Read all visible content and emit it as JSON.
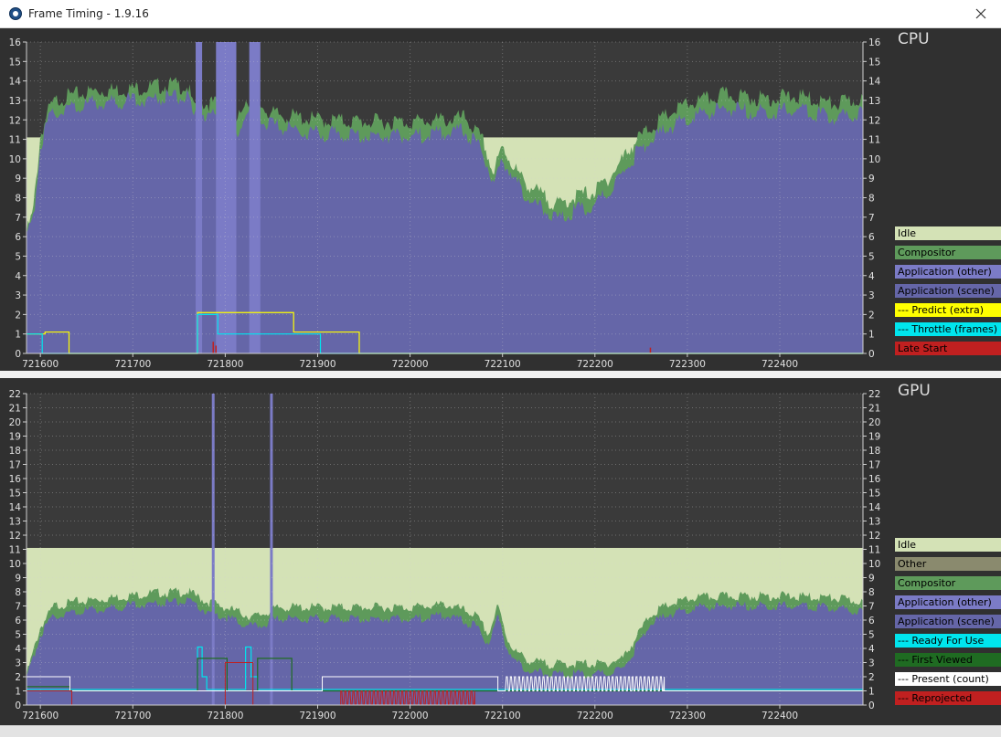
{
  "window": {
    "title": "Frame Timing - 1.9.16"
  },
  "cpu_panel": {
    "title": "CPU",
    "legend": [
      {
        "label": "Idle",
        "bg": "#d4e2b6",
        "fg": "#000000"
      },
      {
        "label": "Compositor",
        "bg": "#5e9a5b",
        "fg": "#000000"
      },
      {
        "label": "Application (other)",
        "bg": "#7b7bc6",
        "fg": "#000000"
      },
      {
        "label": "Application (scene)",
        "bg": "#6566a8",
        "fg": "#000000"
      },
      {
        "label": "--- Predict (extra)",
        "bg": "#ffff00",
        "fg": "#000000"
      },
      {
        "label": "--- Throttle (frames)",
        "bg": "#00e5ee",
        "fg": "#000000"
      },
      {
        "label": "Late Start",
        "bg": "#c02020",
        "fg": "#000000"
      }
    ]
  },
  "gpu_panel": {
    "title": "GPU",
    "legend": [
      {
        "label": "Idle",
        "bg": "#d4e2b6",
        "fg": "#000000"
      },
      {
        "label": "Other",
        "bg": "#8a8a6e",
        "fg": "#000000"
      },
      {
        "label": "Compositor",
        "bg": "#5e9a5b",
        "fg": "#000000"
      },
      {
        "label": "Application (other)",
        "bg": "#7b7bc6",
        "fg": "#000000"
      },
      {
        "label": "Application (scene)",
        "bg": "#6566a8",
        "fg": "#000000"
      },
      {
        "label": "--- Ready For Use",
        "bg": "#00e5ee",
        "fg": "#000000"
      },
      {
        "label": "--- First Viewed",
        "bg": "#1f6b22",
        "fg": "#000000"
      },
      {
        "label": "--- Present (count)",
        "bg": "#ffffff",
        "fg": "#000000"
      },
      {
        "label": "--- Reprojected",
        "bg": "#c02020",
        "fg": "#000000"
      }
    ]
  },
  "chart_data": [
    {
      "type": "area",
      "id": "cpu",
      "title": "CPU",
      "xlabel": "",
      "ylabel": "",
      "xlim": [
        721585,
        722490
      ],
      "ylim": [
        0,
        16
      ],
      "x_ticks": [
        721600,
        721700,
        721800,
        721900,
        722000,
        722100,
        722200,
        722300,
        722400
      ],
      "y_ticks": [
        0,
        1,
        2,
        3,
        4,
        5,
        6,
        7,
        8,
        9,
        10,
        11,
        12,
        13,
        14,
        15,
        16
      ],
      "grid": true,
      "budget_line": 11.1,
      "series": [
        {
          "name": "Idle",
          "color": "#d4e2b6",
          "kind": "fill_to_budget"
        },
        {
          "name": "Compositor",
          "color": "#5e9a5b",
          "kind": "area",
          "x": [
            721585,
            721592,
            721600,
            721610,
            721620,
            721640,
            721660,
            721700,
            721740,
            721760,
            721766,
            721768,
            721800,
            721812,
            721820,
            721830,
            721850,
            721900,
            721950,
            722000,
            722040,
            722060,
            722080,
            722090,
            722100,
            722120,
            722140,
            722160,
            722180,
            722200,
            722220,
            722240,
            722260,
            722280,
            722300,
            722340,
            722380,
            722420,
            722460,
            722490
          ],
          "values": [
            6.2,
            7.2,
            11.2,
            12.6,
            13.1,
            13.3,
            13.5,
            13.6,
            13.8,
            13.7,
            12.5,
            12.9,
            12.8,
            11.6,
            13.0,
            13.1,
            12.3,
            12.0,
            11.9,
            11.9,
            12.0,
            12.1,
            10.8,
            9.2,
            10.6,
            9.0,
            8.2,
            7.6,
            8.1,
            8.3,
            9.3,
            10.7,
            11.6,
            12.3,
            12.8,
            13.3,
            13.1,
            13.2,
            12.8,
            13.1
          ]
        },
        {
          "name": "Application (other)",
          "color": "#7b7bc6",
          "kind": "bars",
          "ranges": [
            [
              721768,
              721775,
              16
            ],
            [
              721790,
              721812,
              16
            ],
            [
              721826,
              721838,
              16
            ]
          ]
        },
        {
          "name": "Application (scene)",
          "color": "#6566a8",
          "kind": "area",
          "x": [
            721585,
            721592,
            721600,
            721610,
            721620,
            721640,
            721660,
            721700,
            721740,
            721760,
            721766,
            721768,
            721800,
            721812,
            721820,
            721830,
            721850,
            721900,
            721950,
            722000,
            722040,
            722060,
            722080,
            722090,
            722100,
            722120,
            722140,
            722160,
            722180,
            722200,
            722220,
            722240,
            722260,
            722280,
            722300,
            722340,
            722380,
            722420,
            722460,
            722490
          ],
          "values": [
            5.9,
            6.8,
            10.7,
            12.1,
            12.5,
            12.7,
            12.9,
            13.0,
            13.2,
            13.1,
            11.9,
            12.3,
            12.2,
            11.0,
            12.3,
            12.4,
            11.7,
            11.3,
            11.2,
            11.2,
            11.3,
            11.4,
            10.2,
            8.6,
            10.0,
            8.4,
            7.5,
            6.9,
            7.4,
            7.6,
            8.6,
            10.0,
            10.9,
            11.6,
            12.1,
            12.6,
            12.4,
            12.5,
            12.1,
            12.4
          ]
        },
        {
          "name": "--- Predict (extra)",
          "color": "#ffff00",
          "kind": "step",
          "x": [
            721585,
            721605,
            721628,
            721631,
            721762,
            721770,
            721871,
            721874,
            721942,
            721945,
            722490
          ],
          "values": [
            1.0,
            1.1,
            1.1,
            0.0,
            0.0,
            2.1,
            2.1,
            1.1,
            1.1,
            0.0,
            0.0
          ]
        },
        {
          "name": "--- Throttle (frames)",
          "color": "#00e5ee",
          "kind": "step",
          "x": [
            721585,
            721600,
            721602,
            721766,
            721770,
            721790,
            721792,
            721901,
            721903,
            722490
          ],
          "values": [
            1.0,
            1.0,
            0.0,
            0.0,
            2.0,
            2.0,
            1.0,
            1.0,
            0.0,
            0.0
          ]
        },
        {
          "name": "Late Start",
          "color": "#c02020",
          "kind": "spikes",
          "x": [
            721787,
            721790,
            722260
          ],
          "values": [
            0.6,
            0.4,
            0.3
          ]
        }
      ]
    },
    {
      "type": "area",
      "id": "gpu",
      "title": "GPU",
      "xlabel": "",
      "ylabel": "",
      "xlim": [
        721585,
        722490
      ],
      "ylim": [
        0,
        22
      ],
      "x_ticks": [
        721600,
        721700,
        721800,
        721900,
        722000,
        722100,
        722200,
        722300,
        722400
      ],
      "y_ticks": [
        0,
        1,
        2,
        3,
        4,
        5,
        6,
        7,
        8,
        9,
        10,
        11,
        12,
        13,
        14,
        15,
        16,
        17,
        18,
        19,
        20,
        21,
        22
      ],
      "grid": true,
      "budget_line": 11.1,
      "series": [
        {
          "name": "Idle",
          "color": "#d4e2b6",
          "kind": "fill_to_budget"
        },
        {
          "name": "Compositor",
          "color": "#5e9a5b",
          "kind": "area",
          "x": [
            721585,
            721600,
            721615,
            721640,
            721680,
            721720,
            721760,
            721780,
            721800,
            721830,
            721860,
            721900,
            721950,
            722000,
            722040,
            722070,
            722085,
            722095,
            722105,
            722115,
            722130,
            722150,
            722180,
            722210,
            722230,
            722245,
            722260,
            722280,
            722310,
            722350,
            722400,
            722450,
            722490
          ],
          "values": [
            2.1,
            5.5,
            7.0,
            7.3,
            7.6,
            7.9,
            8.0,
            7.3,
            6.9,
            6.2,
            6.9,
            6.9,
            6.9,
            6.9,
            7.1,
            6.4,
            5.0,
            7.0,
            4.7,
            3.7,
            3.1,
            2.9,
            2.9,
            2.9,
            3.3,
            4.8,
            6.4,
            7.1,
            7.6,
            7.7,
            7.7,
            7.6,
            7.3
          ]
        },
        {
          "name": "Application (scene)",
          "color": "#6566a8",
          "kind": "area",
          "x": [
            721585,
            721600,
            721615,
            721640,
            721680,
            721720,
            721760,
            721780,
            721800,
            721830,
            721860,
            721900,
            721950,
            722000,
            722040,
            722070,
            722085,
            722095,
            722105,
            722115,
            722130,
            722150,
            722180,
            722210,
            722230,
            722245,
            722260,
            722280,
            722310,
            722350,
            722400,
            722450,
            722490
          ],
          "values": [
            1.8,
            5.0,
            6.3,
            6.6,
            6.9,
            7.2,
            7.3,
            6.6,
            6.2,
            5.5,
            6.1,
            6.1,
            6.1,
            6.1,
            6.3,
            5.6,
            4.3,
            6.3,
            4.0,
            3.0,
            2.4,
            2.2,
            2.2,
            2.2,
            2.6,
            4.1,
            5.7,
            6.4,
            6.9,
            7.0,
            7.0,
            6.9,
            6.6
          ]
        },
        {
          "name": "Application (other)",
          "color": "#7b7bc6",
          "kind": "spikes",
          "x": [
            721787,
            721850
          ],
          "values": [
            22.0,
            22.0
          ]
        },
        {
          "name": "--- Ready For Use",
          "color": "#00e5ee",
          "kind": "step",
          "x": [
            721585,
            721765,
            721770,
            721775,
            721780,
            721800,
            721810,
            721822,
            721828,
            721835,
            721842,
            722490
          ],
          "values": [
            1.1,
            1.1,
            4.1,
            2.0,
            1.1,
            1.1,
            1.1,
            4.1,
            2.0,
            1.1,
            1.1,
            1.1
          ]
        },
        {
          "name": "--- First Viewed",
          "color": "#1f6b22",
          "kind": "step",
          "x": [
            721585,
            721630,
            721632,
            721765,
            721770,
            721800,
            721802,
            721830,
            721835,
            721870,
            721872,
            722490
          ],
          "values": [
            1.3,
            1.3,
            1.0,
            1.0,
            3.3,
            3.3,
            1.0,
            1.0,
            3.3,
            3.3,
            1.0,
            1.0
          ]
        },
        {
          "name": "--- Present (count)",
          "color": "#ffffff",
          "kind": "toggles",
          "x": [
            721585,
            721630,
            721632,
            721900,
            721905,
            722070,
            722095,
            722102,
            722240,
            722275,
            722490
          ],
          "values": [
            2.0,
            2.0,
            1.0,
            1.0,
            2.0,
            2.0,
            1.0,
            1.0,
            2.0,
            1.0,
            1.0
          ]
        },
        {
          "name": "--- Reprojected",
          "color": "#c02020",
          "kind": "toggles",
          "x": [
            721585,
            721632,
            721634,
            721780,
            721800,
            721830,
            721920,
            721925,
            722070,
            722240,
            722275,
            722490
          ],
          "values": [
            1.0,
            1.0,
            0.0,
            0.0,
            3.0,
            0.0,
            0.0,
            1.0,
            0.0,
            0.0,
            0.0,
            0.0
          ]
        }
      ]
    }
  ]
}
